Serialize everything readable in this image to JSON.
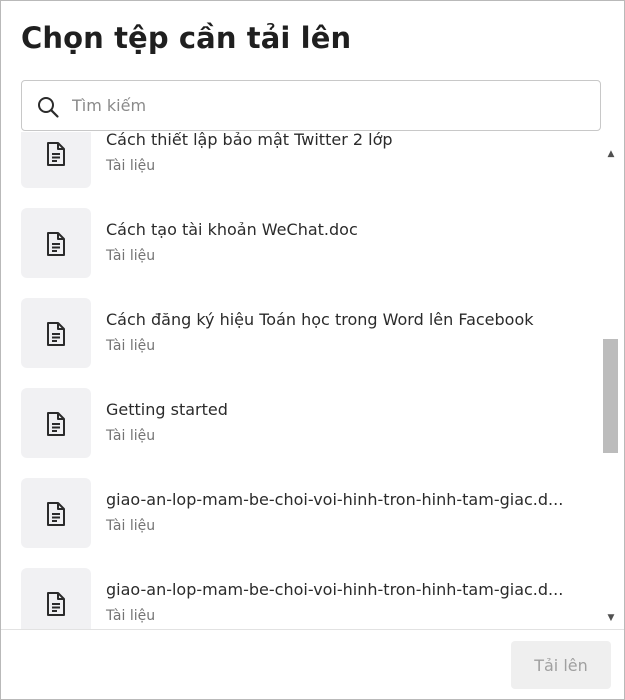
{
  "dialog": {
    "title": "Chọn tệp cần tải lên"
  },
  "search": {
    "placeholder": "Tìm kiếm",
    "icon": "search-icon"
  },
  "files": [
    {
      "name": "Cách thiết lập bảo mật Twitter 2 lớp",
      "type": "Tài liệu",
      "icon": "document-icon"
    },
    {
      "name": "Cách tạo tài khoản WeChat.doc",
      "type": "Tài liệu",
      "icon": "document-icon"
    },
    {
      "name": "Cách đăng ký hiệu Toán học trong Word lên Facebook",
      "type": "Tài liệu",
      "icon": "document-icon"
    },
    {
      "name": "Getting started",
      "type": "Tài liệu",
      "icon": "document-icon"
    },
    {
      "name": "giao-an-lop-mam-be-choi-voi-hinh-tron-hinh-tam-giac.d...",
      "type": "Tài liệu",
      "icon": "document-icon"
    },
    {
      "name": "giao-an-lop-mam-be-choi-voi-hinh-tron-hinh-tam-giac.d...",
      "type": "Tài liệu",
      "icon": "document-icon"
    }
  ],
  "footer": {
    "upload_label": "Tải lên"
  }
}
